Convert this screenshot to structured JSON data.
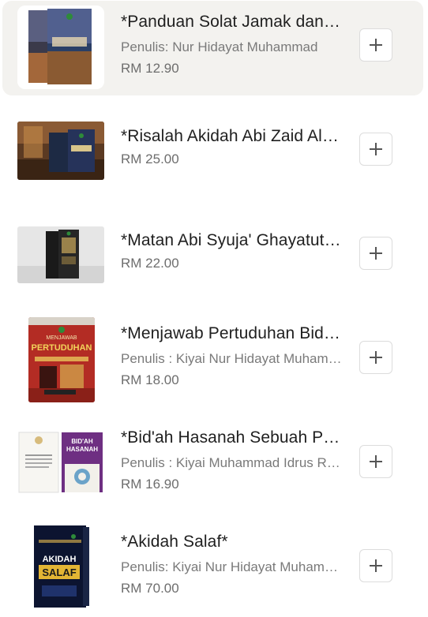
{
  "products": [
    {
      "title": "*Panduan Solat Jamak dan Qasar*",
      "author": "Penulis: Nur Hidayat Muhammad",
      "price": "RM 12.90",
      "cover_icon": "book-cover-panduan-solat"
    },
    {
      "title": "*Risalah Akidah Abi Zaid Al-Qairawani*",
      "author": "",
      "price": "RM 25.00",
      "cover_icon": "book-cover-risalah-akidah"
    },
    {
      "title": "*Matan Abi Syuja' Ghayatut Taqrib*",
      "author": "",
      "price": "RM 22.00",
      "cover_icon": "book-cover-matan-abi-syuja"
    },
    {
      "title": "*Menjawab Pertuduhan Bid'ah*",
      "author": "Penulis : Kiyai Nur Hidayat Muhammad",
      "price": "RM 18.00",
      "cover_icon": "book-cover-menjawab-pertuduhan",
      "cover_text": [
        "MENJAWAB",
        "PERTUDUHAN"
      ]
    },
    {
      "title": "*Bid'ah Hasanah Sebuah Perbahasan*",
      "author": "Penulis : Kiyai Muhammad Idrus Ramli",
      "price": "RM 16.90",
      "cover_icon": "book-cover-bidah-hasanah",
      "cover_text": [
        "BID'AH",
        "HASANAH"
      ]
    },
    {
      "title": "*Akidah Salaf*",
      "author": "Penulis: Kiyai Nur Hidayat Muhammad",
      "price": "RM 70.00",
      "cover_icon": "book-cover-akidah-salaf",
      "cover_text": [
        "AKIDAH",
        "SALAF"
      ]
    }
  ],
  "add_button_icon": "plus-icon",
  "colors": {
    "highlight_bg": "#f3f2ef",
    "price": "#6d6d6d",
    "author": "#7a7a7a"
  }
}
